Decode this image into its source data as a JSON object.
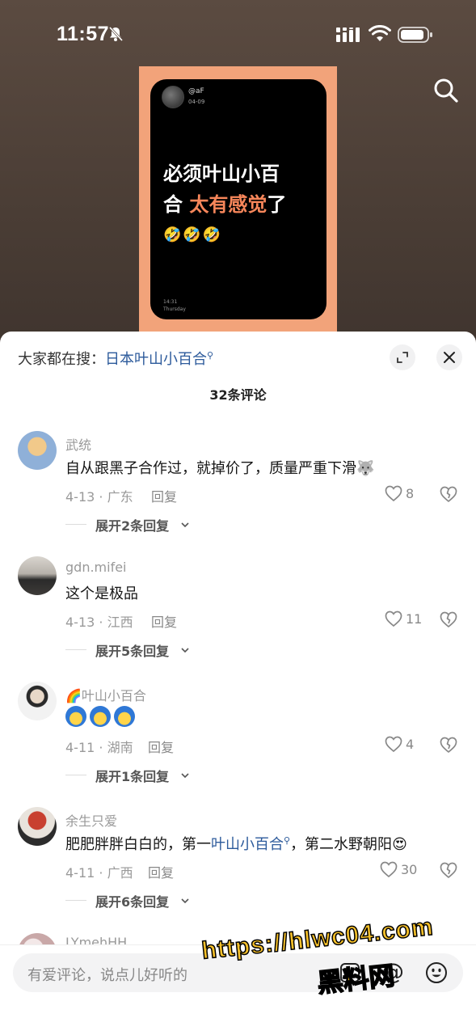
{
  "status_bar": {
    "time": "11:57"
  },
  "video": {
    "handle": "@aF",
    "date": "04-09",
    "title_line1": "必须叶山小百",
    "title_line2_a": "合 ",
    "title_line2_highlight": "太有感觉",
    "title_line2_b": "了",
    "emoji": "🤣🤣🤣",
    "card_time": "14:31",
    "card_day": "Thursday"
  },
  "sheet": {
    "search_prefix": "大家都在搜：",
    "search_link": "日本叶山小百合",
    "comment_count": "32条评论"
  },
  "comments": [
    {
      "name": "武统",
      "text": "自从跟黑子合作过，就掉价了，质量严重下滑",
      "emoji": "🐺",
      "meta": "4-13 · 广东",
      "reply": "回复",
      "likes": "8",
      "expand": "展开2条回复"
    },
    {
      "name": "gdn.mifei",
      "text": "这个是极品",
      "meta": "4-13 · 江西",
      "reply": "回复",
      "likes": "11",
      "expand": "展开5条回复"
    },
    {
      "name": "🌈叶山小百合",
      "meta": "4-11 · 湖南",
      "reply": "回复",
      "likes": "4",
      "expand": "展开1条回复"
    },
    {
      "name": "余生只爱",
      "text_a": "肥肥胖胖白白的，第一",
      "text_link": "叶山小百合",
      "text_b": "，第二水野朝阳",
      "emoji": "😍",
      "meta": "4-11 · 广西",
      "reply": "回复",
      "likes": "30",
      "expand": "展开6条回复"
    }
  ],
  "partial_comment": {
    "name": "LYmehHH"
  },
  "input": {
    "placeholder": "有爱评论，说点儿好听的",
    "at": "@"
  },
  "watermark": {
    "url": "https://hlwc04.com",
    "name": "黑料网"
  },
  "colors": {
    "link": "#2c5a9b",
    "highlight": "#f7865a",
    "cover": "#f2a37a",
    "watermark": "#f7c12a"
  }
}
